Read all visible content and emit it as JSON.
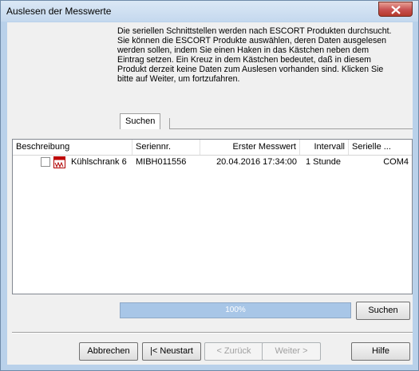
{
  "window": {
    "title": "Auslesen der Messwerte"
  },
  "intro_lines": [
    "Die seriellen Schnittstellen werden nach ESCORT Produkten durchsucht.",
    "Sie können die ESCORT Produkte auswählen, deren Daten ausgelesen",
    "werden sollen, indem Sie einen Haken in das Kästchen neben dem",
    "Eintrag setzen. Ein Kreuz in dem Kästchen bedeutet, daß in diesem",
    "Produkt derzeit keine Daten zum Auslesen vorhanden sind. Klicken Sie",
    "bitte auf Weiter, um fortzufahren."
  ],
  "tab": {
    "label": "Suchen"
  },
  "table": {
    "columns": [
      "Beschreibung",
      "Seriennr.",
      "Erster Messwert",
      "Intervall",
      "Serielle ..."
    ],
    "rows": [
      {
        "description": "Kühlschrank 6",
        "serial": "MIBH011556",
        "first_value": "20.04.2016  17:34:00",
        "interval": "1 Stunde",
        "port": "COM4",
        "checked": false,
        "icon": "fridge-device-icon"
      }
    ]
  },
  "progress": {
    "text": "100%",
    "value": 1.0
  },
  "buttons": {
    "search": "Suchen",
    "cancel": "Abbrechen",
    "restart": "|< Neustart",
    "back": "< Zurück",
    "next": "Weiter >",
    "help": "Hilfe"
  },
  "colors": {
    "titlebar": "#c4d8ee",
    "close": "#c75050",
    "progress": "#a8c6e7"
  }
}
